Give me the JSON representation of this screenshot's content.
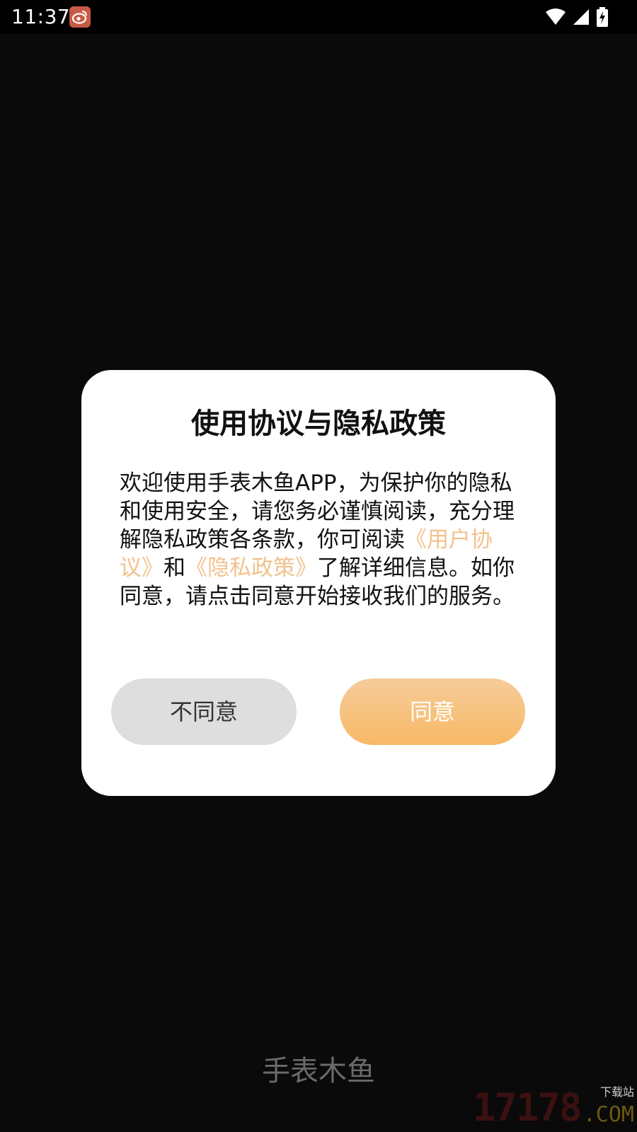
{
  "status_bar": {
    "time": "11:37",
    "notification_icon": "weibo-notification-icon",
    "icons": [
      "wifi-icon",
      "cellular-signal-icon",
      "battery-charging-icon"
    ]
  },
  "dialog": {
    "title": "使用协议与隐私政策",
    "body": {
      "text_1": "欢迎使用手表木鱼APP，为保护你的隐私和使用安全，请您务必谨慎阅读，充分理解隐私政策各条款，你可阅读",
      "link_user_agreement": "《用户协议》",
      "text_and": "和",
      "link_privacy_policy": "《隐私政策》",
      "text_2": "了解详细信息。如你同意，请点击同意开始接收我们的服务。"
    },
    "disagree_label": "不同意",
    "agree_label": "同意",
    "link_color": "#f2c28e",
    "agree_gradient": [
      "#f5cc99",
      "#f8b966"
    ]
  },
  "app_name": "手表木鱼",
  "watermark": {
    "number": "17178",
    "site": "下载站",
    "domain": ".COM"
  }
}
